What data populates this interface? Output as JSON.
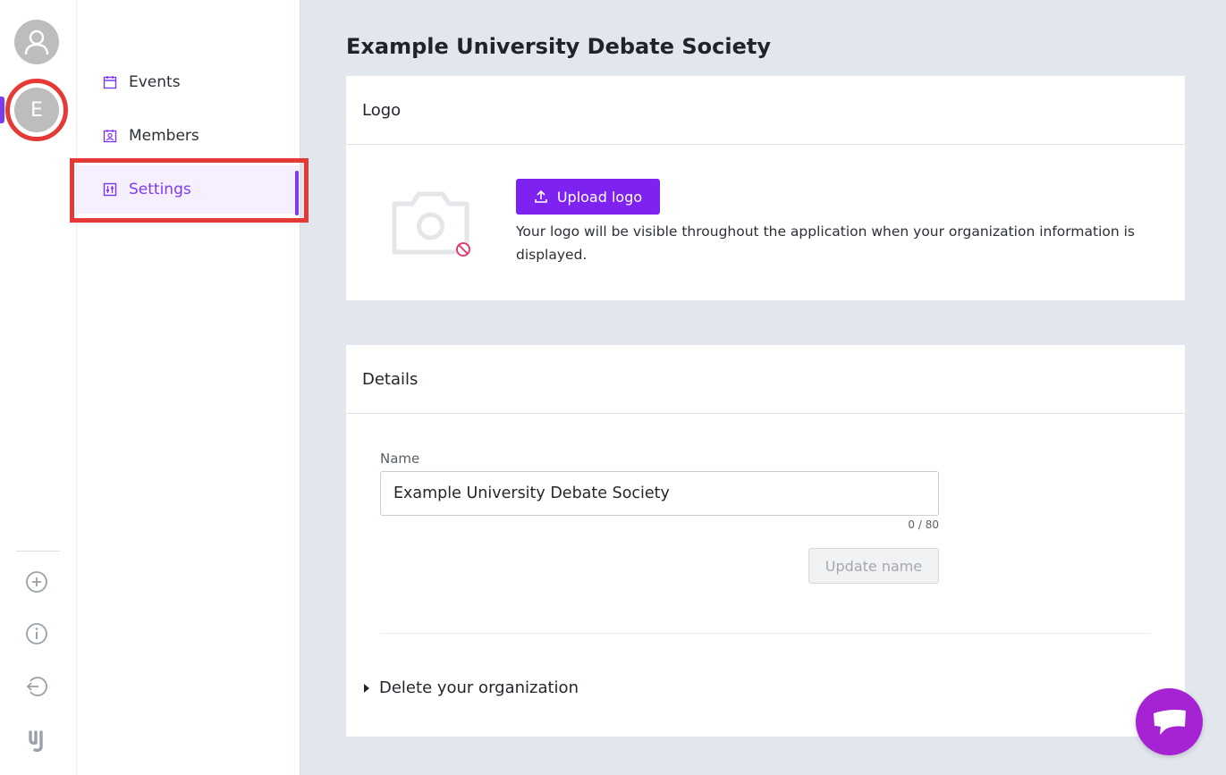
{
  "rail": {
    "org_initial": "E",
    "icons": [
      "user-icon",
      "add-circle-icon",
      "info-icon",
      "logout-icon",
      "brand-logo-icon"
    ]
  },
  "subnav": {
    "items": [
      {
        "label": "Events",
        "icon": "calendar-icon"
      },
      {
        "label": "Members",
        "icon": "id-card-icon"
      },
      {
        "label": "Settings",
        "icon": "sliders-icon",
        "active": true
      }
    ]
  },
  "main": {
    "title": "Example University Debate Society",
    "logo_card": {
      "header": "Logo",
      "upload_label": "Upload logo",
      "help_text": "Your logo will be visible throughout the application when your organization information is displayed."
    },
    "details_card": {
      "header": "Details",
      "name_label": "Name",
      "name_value": "Example University Debate Society",
      "counter": "0 / 80",
      "update_label": "Update name",
      "delete_label": "Delete your organization"
    }
  },
  "colors": {
    "accent": "#7e22f2",
    "highlight": "#e53935",
    "chat": "#a623d4"
  }
}
